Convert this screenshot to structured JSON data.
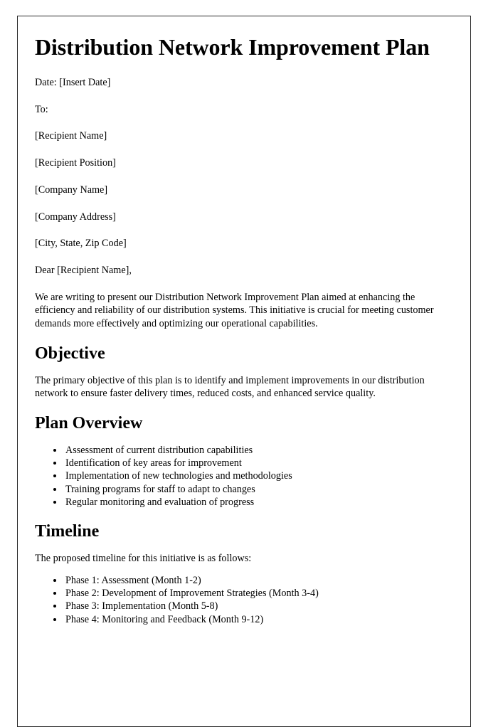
{
  "document": {
    "title": "Distribution Network Improvement Plan",
    "date_line": "Date: [Insert Date]",
    "to_label": "To:",
    "recipient": {
      "name": "[Recipient Name]",
      "position": "[Recipient Position]",
      "company": "[Company Name]",
      "address": "[Company Address]",
      "city_state_zip": "[City, State, Zip Code]"
    },
    "salutation": "Dear [Recipient Name],",
    "intro_paragraph": "We are writing to present our Distribution Network Improvement Plan aimed at enhancing the efficiency and reliability of our distribution systems. This initiative is crucial for meeting customer demands more effectively and optimizing our operational capabilities.",
    "sections": {
      "objective": {
        "heading": "Objective",
        "paragraph": "The primary objective of this plan is to identify and implement improvements in our distribution network to ensure faster delivery times, reduced costs, and enhanced service quality."
      },
      "plan_overview": {
        "heading": "Plan Overview",
        "items": [
          "Assessment of current distribution capabilities",
          "Identification of key areas for improvement",
          "Implementation of new technologies and methodologies",
          "Training programs for staff to adapt to changes",
          "Regular monitoring and evaluation of progress"
        ]
      },
      "timeline": {
        "heading": "Timeline",
        "lead_in": "The proposed timeline for this initiative is as follows:",
        "items": [
          "Phase 1: Assessment (Month 1-2)",
          "Phase 2: Development of Improvement Strategies (Month 3-4)",
          "Phase 3: Implementation (Month 5-8)",
          "Phase 4: Monitoring and Feedback (Month 9-12)"
        ]
      }
    }
  }
}
